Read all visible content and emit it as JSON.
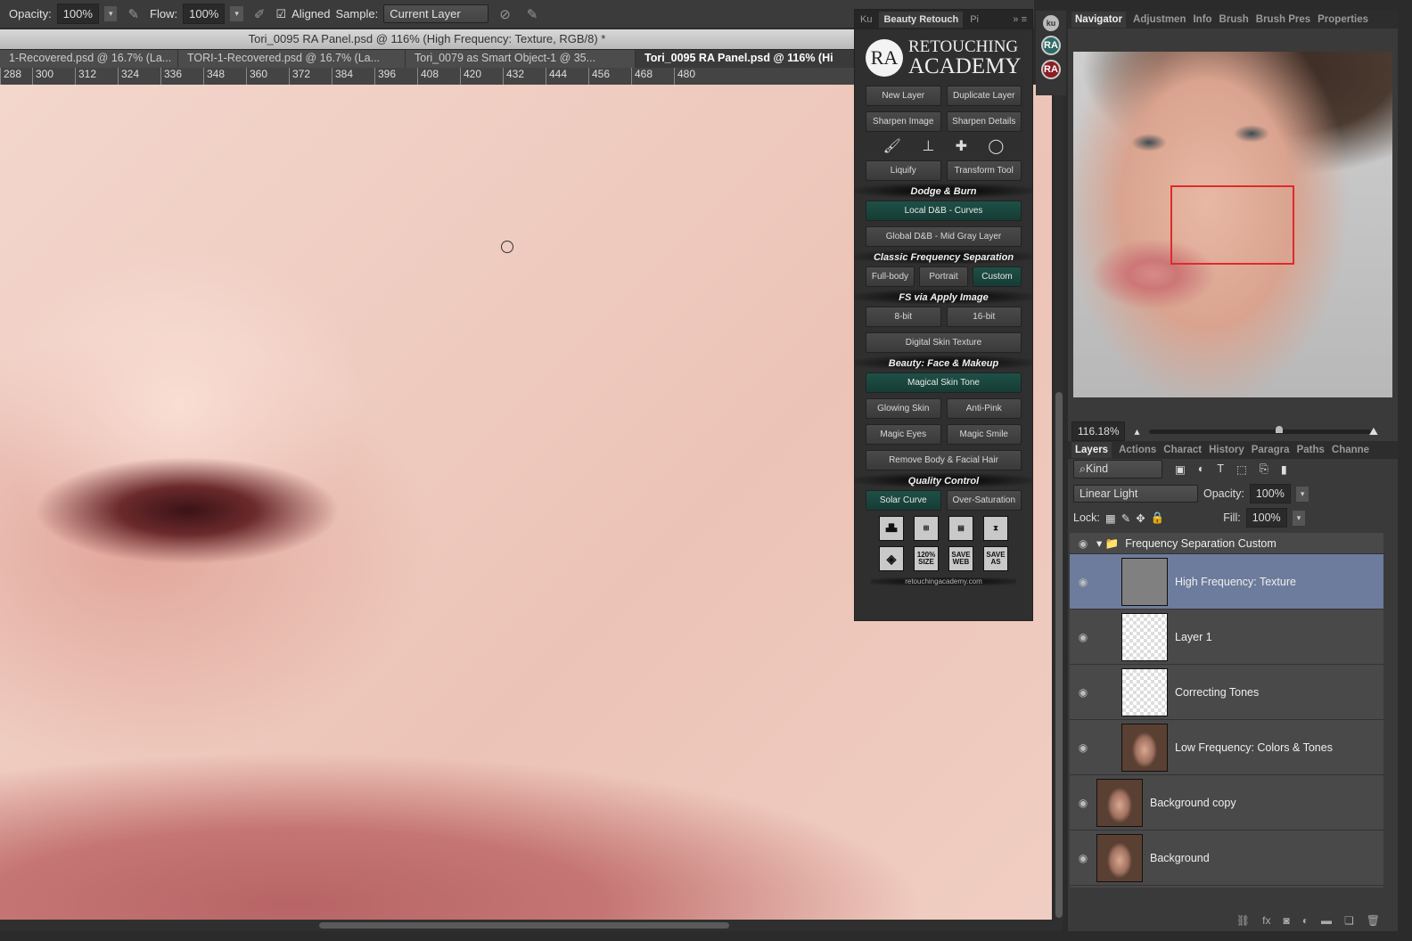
{
  "options_bar": {
    "opacity_label": "Opacity:",
    "opacity": "100%",
    "flow_label": "Flow:",
    "flow": "100%",
    "aligned_label": "Aligned",
    "aligned_checked": true,
    "sample_label": "Sample:",
    "sample": "Current Layer"
  },
  "window_title": "Tori_0095 RA Panel.psd @ 116% (High Frequency: Texture, RGB/8) *",
  "doc_tabs": [
    "1-Recovered.psd @ 16.7% (La...",
    "TORI-1-Recovered.psd @ 16.7% (La...",
    "Tori_0079 as Smart Object-1 @ 35...",
    "Tori_0095 RA Panel.psd @ 116% (Hi"
  ],
  "ruler": [
    "288",
    "300",
    "312",
    "324",
    "336",
    "348",
    "360",
    "372",
    "384",
    "396",
    "408",
    "420",
    "432",
    "444",
    "456",
    "468",
    "480"
  ],
  "ra_panel": {
    "tabs": [
      "Ku",
      "Beauty Retouch",
      "Pi"
    ],
    "logo_mark": "RA",
    "logo_line1": "RETOUCHING",
    "logo_line2": "ACADEMY",
    "b": {
      "new_layer": "New Layer",
      "duplicate_layer": "Duplicate Layer",
      "sharpen_image": "Sharpen Image",
      "sharpen_details": "Sharpen Details",
      "liquify": "Liquify",
      "transform_tool": "Transform Tool",
      "dodge_burn": "Dodge & Burn",
      "local_db": "Local D&B - Curves",
      "global_db": "Global D&B - Mid Gray Layer",
      "classic_fs": "Classic Frequency Separation",
      "full_body": "Full-body",
      "portrait": "Portrait",
      "custom": "Custom",
      "fs_apply": "FS via Apply Image",
      "bit8": "8-bit",
      "bit16": "16-bit",
      "digital_skin": "Digital Skin Texture",
      "beauty": "Beauty: Face & Makeup",
      "magical_skin": "Magical Skin Tone",
      "glowing_skin": "Glowing Skin",
      "anti_pink": "Anti-Pink",
      "magic_eyes": "Magic Eyes",
      "magic_smile": "Magic Smile",
      "remove_hair": "Remove Body & Facial Hair",
      "quality": "Quality Control",
      "solar_curve": "Solar Curve",
      "over_saturation": "Over-Saturation",
      "size120": "120% SIZE",
      "save_web": "SAVE WEB",
      "save_as": "SAVE AS",
      "url": "retouchingacademy.com"
    }
  },
  "strip": [
    "ku",
    "RA",
    "RA"
  ],
  "navigator": {
    "tabs": [
      "Navigator",
      "Adjustmen",
      "Info",
      "Brush",
      "Brush Pres",
      "Properties"
    ],
    "zoom": "116.18%"
  },
  "layers_panel": {
    "tabs": [
      "Layers",
      "Actions",
      "Charact",
      "History",
      "Paragra",
      "Paths",
      "Channe"
    ],
    "filter": "Kind",
    "blend_mode": "Linear Light",
    "opacity_label": "Opacity:",
    "opacity": "100%",
    "lock_label": "Lock:",
    "fill_label": "Fill:",
    "fill": "100%",
    "group": "Frequency Separation Custom",
    "layers": [
      "High Frequency: Texture",
      "Layer 1",
      "Correcting Tones",
      "Low Frequency: Colors & Tones",
      "Background copy",
      "Background"
    ]
  }
}
